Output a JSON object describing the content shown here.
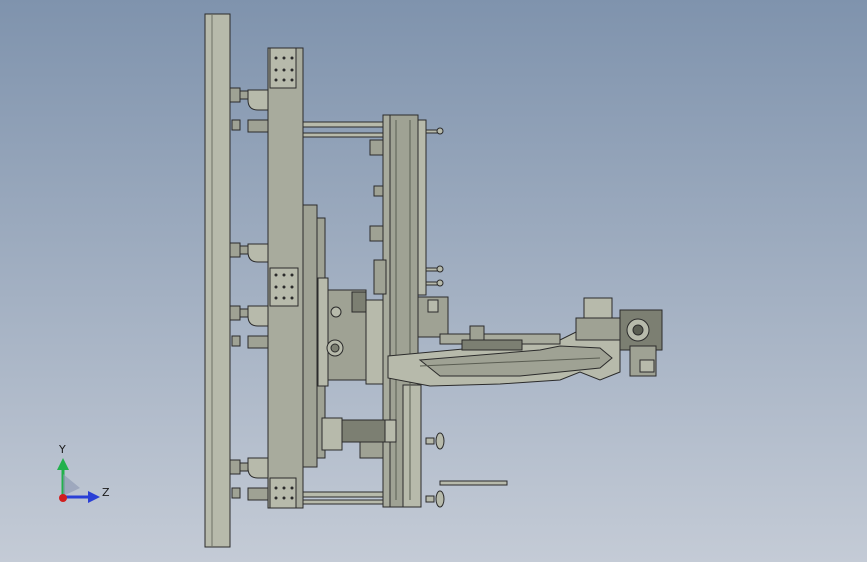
{
  "viewport": {
    "background_top": "#7f93ad",
    "background_bottom": "#c4cbd6",
    "part_fill": "#9fa294",
    "part_fill_light": "#b7baab",
    "part_fill_dark": "#7c7f72",
    "edge_color": "#2b2b2b"
  },
  "triad": {
    "y_label": "Y",
    "z_label": "Z",
    "y_color": "#22b14c",
    "z_color": "#2a3fd6",
    "x_color": "#d01e1e"
  }
}
